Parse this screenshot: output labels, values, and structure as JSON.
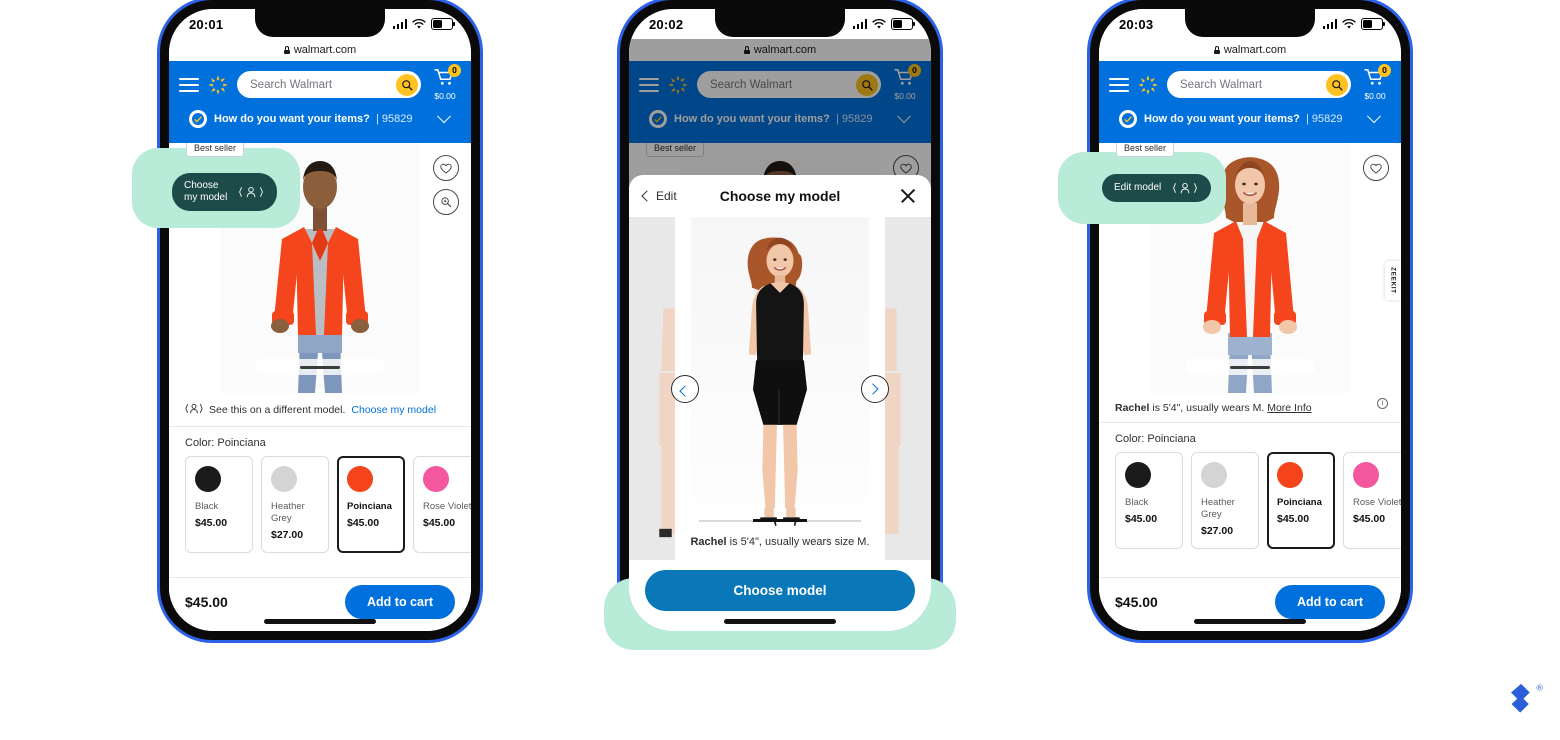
{
  "browser": {
    "url": "walmart.com",
    "lock_icon": "lock-icon"
  },
  "header": {
    "menu_icon": "hamburger-menu-icon",
    "logo_icon": "walmart-spark-icon",
    "search_placeholder": "Search Walmart",
    "search_icon": "search-icon",
    "cart_icon": "cart-icon",
    "cart_count": "0",
    "cart_total": "$0.00",
    "fulfillment_text": "How do you want your items?",
    "fulfillment_sep": "|",
    "fulfillment_zip": "95829",
    "chevron_icon": "chevron-down-icon"
  },
  "pdp": {
    "best_seller_badge": "Best seller",
    "favorite_icon": "heart-icon",
    "zoom_icon": "magnifier-icon",
    "see_on_model_text": "See this on a different model.",
    "see_on_model_link": "Choose my model",
    "person_icon": "person-model-icon",
    "model_caption_name": "Rachel",
    "model_caption_rest": " is 5'4\", usually wears M. ",
    "model_caption_more": "More Info",
    "color_label": "Color: Poinciana",
    "swatches": [
      {
        "name": "Black",
        "price": "$45.00",
        "color": "#1b1b1b",
        "selected": false
      },
      {
        "name": "Heather Grey",
        "price": "$27.00",
        "color": "#d4d4d4",
        "selected": false
      },
      {
        "name": "Poinciana",
        "price": "$45.00",
        "color": "#f5431b",
        "selected": true
      },
      {
        "name": "Rose Violet",
        "price": "$45.00",
        "color": "#f3589f",
        "selected": false
      }
    ],
    "foot_price": "$45.00",
    "add_to_cart": "Add to cart"
  },
  "phones": [
    {
      "time": "20:01",
      "pill_label_line1": "Choose",
      "pill_label_line2": "my model",
      "state": "default"
    },
    {
      "time": "20:02",
      "state": "modal"
    },
    {
      "time": "20:03",
      "pill_label_line1": "Edit model",
      "pill_label_line2": "",
      "state": "model-applied"
    }
  ],
  "modal": {
    "back_label": "Edit",
    "back_icon": "chevron-left-icon",
    "title": "Choose my model",
    "close_icon": "close-icon",
    "prev_icon": "chevron-left-circle-icon",
    "next_icon": "chevron-right-circle-icon",
    "caption_name": "Rachel",
    "caption_rest": " is 5'4\", usually wears size M.",
    "cta_label": "Choose model",
    "carousel_index": 2,
    "carousel_total": 3
  },
  "zeekit": {
    "label": "ZEEKIT",
    "info_icon": "info-icon"
  },
  "brand": {
    "mark": "brand-logo-icon",
    "trademark": "®"
  },
  "colors": {
    "walmart_blue": "#0071dc",
    "walmart_yellow": "#ffc220",
    "pill_teal": "#1c4b49",
    "halo_mint": "#b9ecd8",
    "cta_blue": "#0a77b8",
    "phone_border": "#2b62e8"
  }
}
